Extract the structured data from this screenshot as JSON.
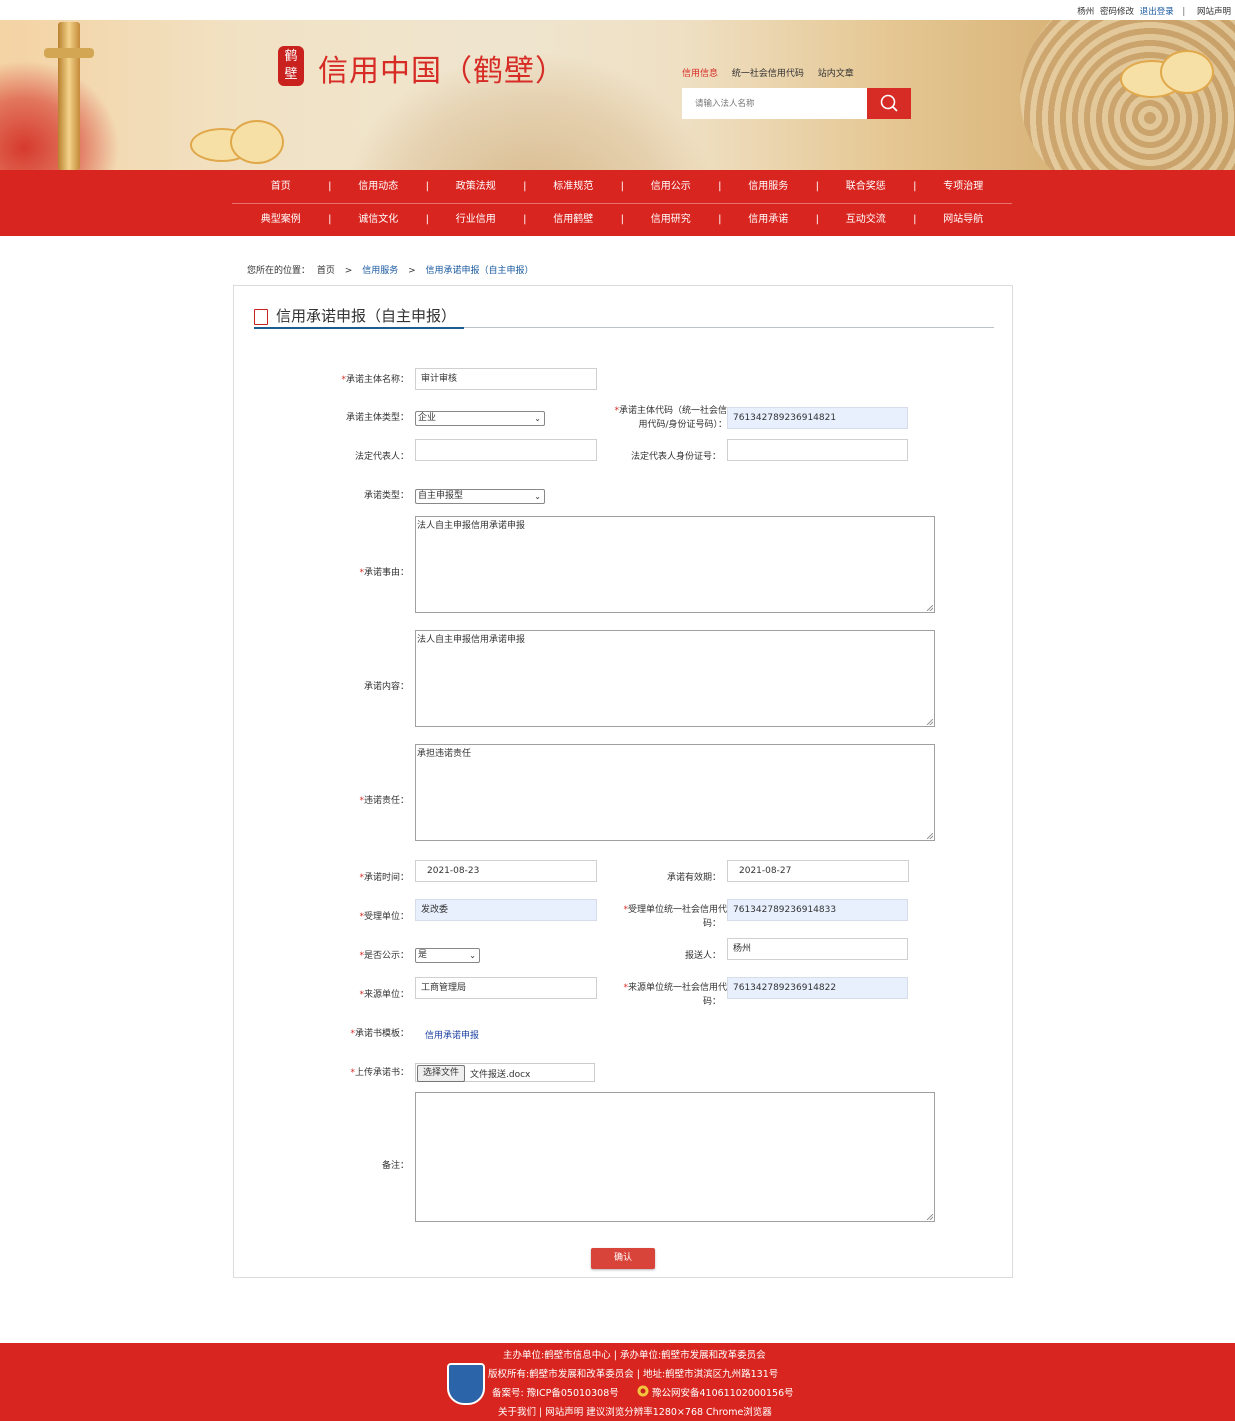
{
  "topbar": {
    "user": "杨州",
    "change_password": "密码修改",
    "logout": "退出登录",
    "sep": "|",
    "statement": "网站声明"
  },
  "header": {
    "seal": "鹤壁",
    "site_title": "信用中国（鹤壁）",
    "search_tabs": [
      "信用信息",
      "统一社会信用代码",
      "站内文章"
    ],
    "search_placeholder": "请输入法人名称"
  },
  "nav": {
    "row1": [
      "首页",
      "信用动态",
      "政策法规",
      "标准规范",
      "信用公示",
      "信用服务",
      "联合奖惩",
      "专项治理"
    ],
    "row2": [
      "典型案例",
      "诚信文化",
      "行业信用",
      "信用鹤壁",
      "信用研究",
      "信用承诺",
      "互动交流",
      "网站导航"
    ],
    "separator": "|"
  },
  "breadcrumb": {
    "prefix": "您所在的位置：",
    "home": "首页",
    "gt": ">",
    "level1": "信用服务",
    "level2": "信用承诺申报（自主申报）"
  },
  "form": {
    "title": "信用承诺申报（自主申报）",
    "req": "*",
    "labels": {
      "subject_name": "承诺主体名称：",
      "subject_type": "承诺主体类型：",
      "subject_code": "承诺主体代码（统一社会信",
      "subject_code2": "用代码/身份证号码）：",
      "legal_rep": "法定代表人：",
      "legal_rep_id": "法定代表人身份证号：",
      "promise_type": "承诺类型：",
      "reason": "承诺事由：",
      "content": "承诺内容：",
      "liability": "违诺责任：",
      "promise_date": "承诺时间：",
      "valid_until": "承诺有效期：",
      "accept_unit": "受理单位：",
      "accept_code": "受理单位统一社会信用代",
      "accept_code2": "码：",
      "is_public": "是否公示：",
      "reporter": "报送人：",
      "source_unit": "来源单位：",
      "source_code": "来源单位统一社会信用代",
      "source_code2": "码：",
      "template": "承诺书模板：",
      "upload": "上传承诺书：",
      "remark": "备注："
    },
    "values": {
      "subject_name": "审计审核",
      "subject_type": "企业",
      "subject_code": "761342789236914821",
      "legal_rep": "",
      "legal_rep_id": "",
      "promise_type": "自主申报型",
      "reason": "法人自主申报信用承诺申报",
      "content": "法人自主申报信用承诺申报",
      "liability": "承担违诺责任",
      "promise_date": "2021-08-23",
      "valid_until": "2021-08-27",
      "accept_unit": "发改委",
      "accept_code": "761342789236914833",
      "is_public": "是",
      "reporter": "杨州",
      "source_unit": "工商管理局",
      "source_code": "761342789236914822",
      "template_link": "信用承诺申报",
      "file_button": "选择文件",
      "file_name": "文件报送.docx",
      "remark": ""
    },
    "confirm": "确认"
  },
  "footer": {
    "line1": "主办单位:鹤壁市信息中心 |   承办单位:鹤壁市发展和改革委员会",
    "line2": "版权所有:鹤壁市发展和改革委员会 |   地址:鹤壁市淇滨区九州路131号",
    "line3a": "备案号:   豫ICP备05010308号",
    "line3b": "豫公网安备41061102000156号",
    "line4": "关于我们 |   网站声明  建议浏览分辨率1280×768 Chrome浏览器"
  },
  "colors": {
    "brand_red": "#d9251f",
    "link_blue": "#1a5aa0"
  }
}
